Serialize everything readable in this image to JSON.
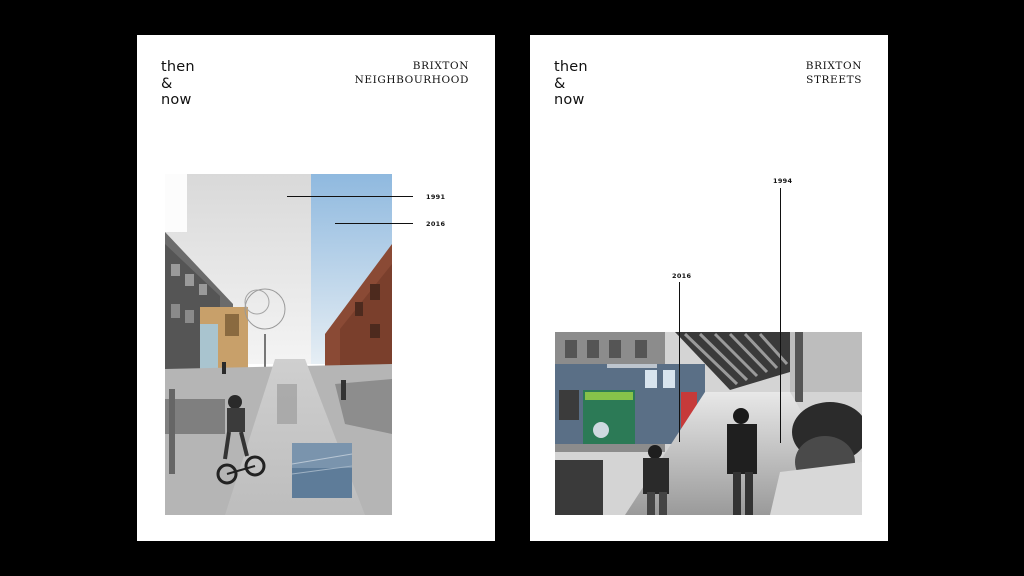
{
  "posters": [
    {
      "logo": [
        "then",
        "&",
        "now"
      ],
      "place": [
        "BRIXTON",
        "NEIGHBOURHOOD"
      ],
      "years": [
        "1991",
        "2016"
      ],
      "photo_description_icon": "street-collage-photo"
    },
    {
      "logo": [
        "then",
        "&",
        "now"
      ],
      "place": [
        "BRIXTON",
        "STREETS"
      ],
      "years": [
        "1994",
        "2016"
      ],
      "photo_description_icon": "shopping-street-collage-photo"
    }
  ],
  "colors": {
    "background": "#000000",
    "paper": "#ffffff",
    "ink": "#111111",
    "sky": "#a8cbe6",
    "brick": "#8a4a35",
    "tile": "#5e7c99",
    "shopfront": "#2c7a56"
  }
}
